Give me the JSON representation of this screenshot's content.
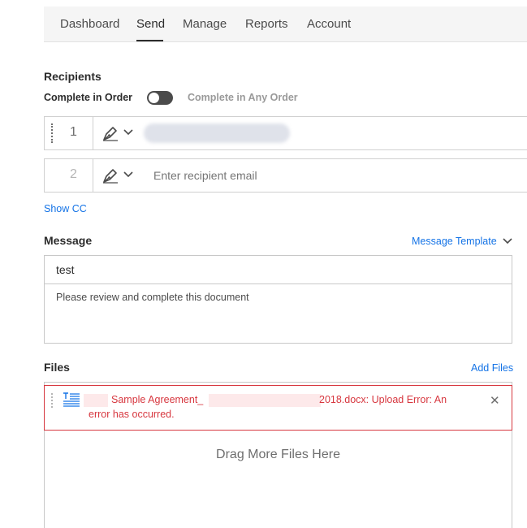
{
  "nav": {
    "tabs": [
      {
        "label": "Dashboard",
        "active": false
      },
      {
        "label": "Send",
        "active": true
      },
      {
        "label": "Manage",
        "active": false
      },
      {
        "label": "Reports",
        "active": false
      },
      {
        "label": "Account",
        "active": false
      }
    ]
  },
  "recipients": {
    "title": "Recipients",
    "order_label": "Complete in Order",
    "any_order_label": "Complete in Any Order",
    "toggle_on": false,
    "rows": [
      {
        "number": "1",
        "email": "",
        "redacted": true
      },
      {
        "number": "2",
        "email": "",
        "placeholder": "Enter recipient email"
      }
    ],
    "show_cc": "Show CC"
  },
  "message": {
    "title": "Message",
    "template_link": "Message Template",
    "subject": "test",
    "body": "Please review and complete this document"
  },
  "files": {
    "title": "Files",
    "add_link": "Add Files",
    "error_line1_a": "Sample Agreement_",
    "error_line1_b": "2018.docx: Upload Error: An",
    "error_line2": "error has occurred.",
    "drop_text": "Drag More Files Here"
  },
  "colors": {
    "accent": "#1473e6",
    "error": "#d7373f",
    "nav_bg": "#f5f5f5"
  }
}
